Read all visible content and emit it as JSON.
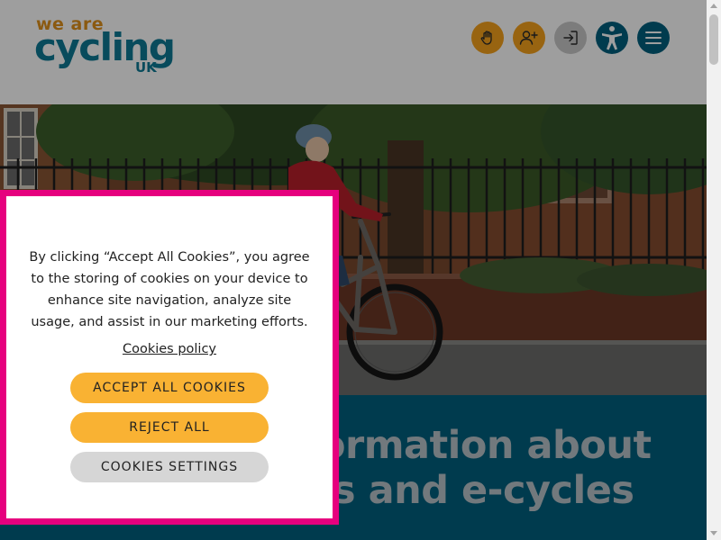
{
  "header": {
    "logo": {
      "line1": "we are",
      "line2": "cycling",
      "line3": "UK"
    },
    "buttons": {
      "donate_icon": "hand-icon",
      "join_icon": "add-user-icon",
      "login_icon": "sign-in-icon",
      "accessibility_icon": "accessibility-icon",
      "menu_icon": "hamburger-menu-icon"
    },
    "colors": {
      "logo_orange": "#e0921c",
      "logo_teal": "#0d7a95",
      "accent_orange": "#f5a21c",
      "dark_teal": "#00607e",
      "grey": "#c9c9c9"
    }
  },
  "hero": {
    "image": "woman riding an e-bike past railings and trees",
    "headline_line1": "ormation about",
    "headline_line2": "s and e-cycles"
  },
  "cookie_banner": {
    "message": "By clicking “Accept All Cookies”, you agree to the storing of cookies on your device to enhance site navigation, analyze site usage, and assist in our marketing efforts.",
    "policy_link": "Cookies policy",
    "accept_label": "ACCEPT ALL COOKIES",
    "reject_label": "REJECT ALL",
    "settings_label": "COOKIES SETTINGS",
    "colors": {
      "border": "#e6007e",
      "primary_button": "#f9b233",
      "secondary_button": "#d6d6d6"
    }
  }
}
